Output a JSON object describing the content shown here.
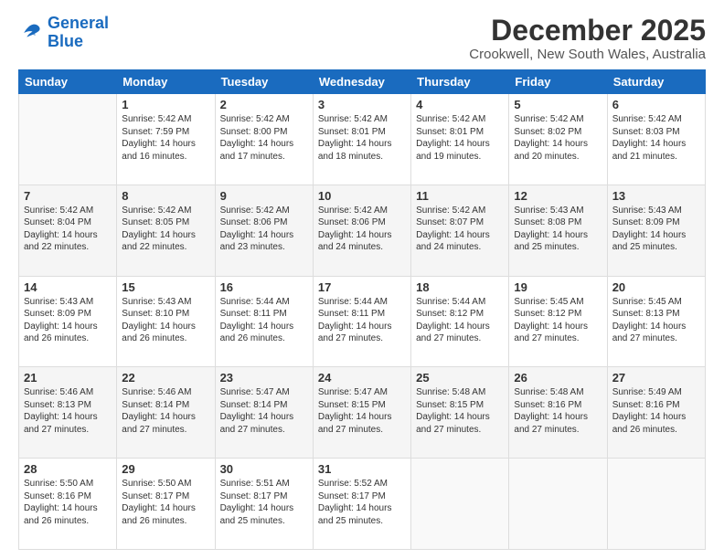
{
  "logo": {
    "line1": "General",
    "line2": "Blue"
  },
  "title": "December 2025",
  "location": "Crookwell, New South Wales, Australia",
  "days_of_week": [
    "Sunday",
    "Monday",
    "Tuesday",
    "Wednesday",
    "Thursday",
    "Friday",
    "Saturday"
  ],
  "weeks": [
    [
      {
        "day": "",
        "sunrise": "",
        "sunset": "",
        "daylight": ""
      },
      {
        "day": "1",
        "sunrise": "Sunrise: 5:42 AM",
        "sunset": "Sunset: 7:59 PM",
        "daylight": "Daylight: 14 hours and 16 minutes."
      },
      {
        "day": "2",
        "sunrise": "Sunrise: 5:42 AM",
        "sunset": "Sunset: 8:00 PM",
        "daylight": "Daylight: 14 hours and 17 minutes."
      },
      {
        "day": "3",
        "sunrise": "Sunrise: 5:42 AM",
        "sunset": "Sunset: 8:01 PM",
        "daylight": "Daylight: 14 hours and 18 minutes."
      },
      {
        "day": "4",
        "sunrise": "Sunrise: 5:42 AM",
        "sunset": "Sunset: 8:01 PM",
        "daylight": "Daylight: 14 hours and 19 minutes."
      },
      {
        "day": "5",
        "sunrise": "Sunrise: 5:42 AM",
        "sunset": "Sunset: 8:02 PM",
        "daylight": "Daylight: 14 hours and 20 minutes."
      },
      {
        "day": "6",
        "sunrise": "Sunrise: 5:42 AM",
        "sunset": "Sunset: 8:03 PM",
        "daylight": "Daylight: 14 hours and 21 minutes."
      }
    ],
    [
      {
        "day": "7",
        "sunrise": "Sunrise: 5:42 AM",
        "sunset": "Sunset: 8:04 PM",
        "daylight": "Daylight: 14 hours and 22 minutes."
      },
      {
        "day": "8",
        "sunrise": "Sunrise: 5:42 AM",
        "sunset": "Sunset: 8:05 PM",
        "daylight": "Daylight: 14 hours and 22 minutes."
      },
      {
        "day": "9",
        "sunrise": "Sunrise: 5:42 AM",
        "sunset": "Sunset: 8:06 PM",
        "daylight": "Daylight: 14 hours and 23 minutes."
      },
      {
        "day": "10",
        "sunrise": "Sunrise: 5:42 AM",
        "sunset": "Sunset: 8:06 PM",
        "daylight": "Daylight: 14 hours and 24 minutes."
      },
      {
        "day": "11",
        "sunrise": "Sunrise: 5:42 AM",
        "sunset": "Sunset: 8:07 PM",
        "daylight": "Daylight: 14 hours and 24 minutes."
      },
      {
        "day": "12",
        "sunrise": "Sunrise: 5:43 AM",
        "sunset": "Sunset: 8:08 PM",
        "daylight": "Daylight: 14 hours and 25 minutes."
      },
      {
        "day": "13",
        "sunrise": "Sunrise: 5:43 AM",
        "sunset": "Sunset: 8:09 PM",
        "daylight": "Daylight: 14 hours and 25 minutes."
      }
    ],
    [
      {
        "day": "14",
        "sunrise": "Sunrise: 5:43 AM",
        "sunset": "Sunset: 8:09 PM",
        "daylight": "Daylight: 14 hours and 26 minutes."
      },
      {
        "day": "15",
        "sunrise": "Sunrise: 5:43 AM",
        "sunset": "Sunset: 8:10 PM",
        "daylight": "Daylight: 14 hours and 26 minutes."
      },
      {
        "day": "16",
        "sunrise": "Sunrise: 5:44 AM",
        "sunset": "Sunset: 8:11 PM",
        "daylight": "Daylight: 14 hours and 26 minutes."
      },
      {
        "day": "17",
        "sunrise": "Sunrise: 5:44 AM",
        "sunset": "Sunset: 8:11 PM",
        "daylight": "Daylight: 14 hours and 27 minutes."
      },
      {
        "day": "18",
        "sunrise": "Sunrise: 5:44 AM",
        "sunset": "Sunset: 8:12 PM",
        "daylight": "Daylight: 14 hours and 27 minutes."
      },
      {
        "day": "19",
        "sunrise": "Sunrise: 5:45 AM",
        "sunset": "Sunset: 8:12 PM",
        "daylight": "Daylight: 14 hours and 27 minutes."
      },
      {
        "day": "20",
        "sunrise": "Sunrise: 5:45 AM",
        "sunset": "Sunset: 8:13 PM",
        "daylight": "Daylight: 14 hours and 27 minutes."
      }
    ],
    [
      {
        "day": "21",
        "sunrise": "Sunrise: 5:46 AM",
        "sunset": "Sunset: 8:13 PM",
        "daylight": "Daylight: 14 hours and 27 minutes."
      },
      {
        "day": "22",
        "sunrise": "Sunrise: 5:46 AM",
        "sunset": "Sunset: 8:14 PM",
        "daylight": "Daylight: 14 hours and 27 minutes."
      },
      {
        "day": "23",
        "sunrise": "Sunrise: 5:47 AM",
        "sunset": "Sunset: 8:14 PM",
        "daylight": "Daylight: 14 hours and 27 minutes."
      },
      {
        "day": "24",
        "sunrise": "Sunrise: 5:47 AM",
        "sunset": "Sunset: 8:15 PM",
        "daylight": "Daylight: 14 hours and 27 minutes."
      },
      {
        "day": "25",
        "sunrise": "Sunrise: 5:48 AM",
        "sunset": "Sunset: 8:15 PM",
        "daylight": "Daylight: 14 hours and 27 minutes."
      },
      {
        "day": "26",
        "sunrise": "Sunrise: 5:48 AM",
        "sunset": "Sunset: 8:16 PM",
        "daylight": "Daylight: 14 hours and 27 minutes."
      },
      {
        "day": "27",
        "sunrise": "Sunrise: 5:49 AM",
        "sunset": "Sunset: 8:16 PM",
        "daylight": "Daylight: 14 hours and 26 minutes."
      }
    ],
    [
      {
        "day": "28",
        "sunrise": "Sunrise: 5:50 AM",
        "sunset": "Sunset: 8:16 PM",
        "daylight": "Daylight: 14 hours and 26 minutes."
      },
      {
        "day": "29",
        "sunrise": "Sunrise: 5:50 AM",
        "sunset": "Sunset: 8:17 PM",
        "daylight": "Daylight: 14 hours and 26 minutes."
      },
      {
        "day": "30",
        "sunrise": "Sunrise: 5:51 AM",
        "sunset": "Sunset: 8:17 PM",
        "daylight": "Daylight: 14 hours and 25 minutes."
      },
      {
        "day": "31",
        "sunrise": "Sunrise: 5:52 AM",
        "sunset": "Sunset: 8:17 PM",
        "daylight": "Daylight: 14 hours and 25 minutes."
      },
      {
        "day": "",
        "sunrise": "",
        "sunset": "",
        "daylight": ""
      },
      {
        "day": "",
        "sunrise": "",
        "sunset": "",
        "daylight": ""
      },
      {
        "day": "",
        "sunrise": "",
        "sunset": "",
        "daylight": ""
      }
    ]
  ]
}
